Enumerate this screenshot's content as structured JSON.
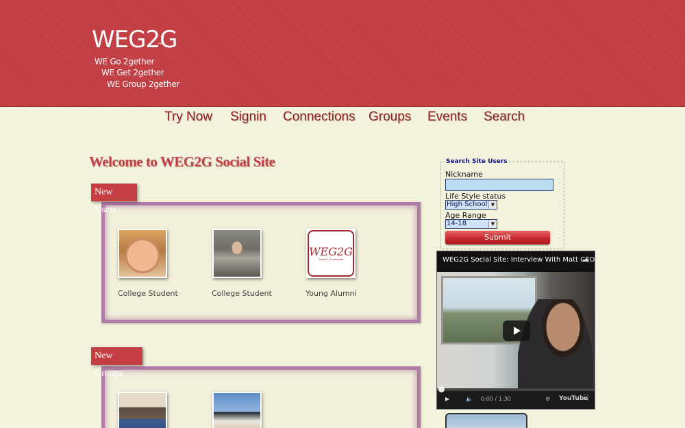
{
  "header": {
    "logo": "WEG2G",
    "logo_tm": "™",
    "taglines": [
      "WE Go 2gether",
      "WE Get 2gether",
      "WE Group 2gether"
    ]
  },
  "nav": [
    "Try Now",
    "Signin",
    "Connections",
    "Groups",
    "Events",
    "Search"
  ],
  "welcome_title": "Welcome to WEG2G Social Site",
  "new_users": {
    "label": "New Users",
    "users": [
      {
        "caption": "College Student"
      },
      {
        "caption": "College Student"
      },
      {
        "caption": "Young Alumni",
        "logo_text": "WEG2G",
        "logo_sub": "Social 4 Community"
      }
    ]
  },
  "new_groups": {
    "label": "New Groups"
  },
  "search": {
    "legend": "Search  Site Users",
    "nickname_label": "Nickname",
    "nickname_value": "",
    "lifestyle_label": "Life Style status",
    "lifestyle_value": "High  School",
    "age_label": "Age Range",
    "age_value": "14-18",
    "submit_label": "Submit"
  },
  "video": {
    "title": "WEG2G Social Site: Interview With Matt CEO",
    "time": "0:00 / 1:30",
    "brand": "YouTube"
  },
  "colors": {
    "header_bg": "#c43e44",
    "page_bg": "#f3f2dc",
    "nav_text": "#8e1e1e",
    "panel_border": "#b17ba7"
  }
}
